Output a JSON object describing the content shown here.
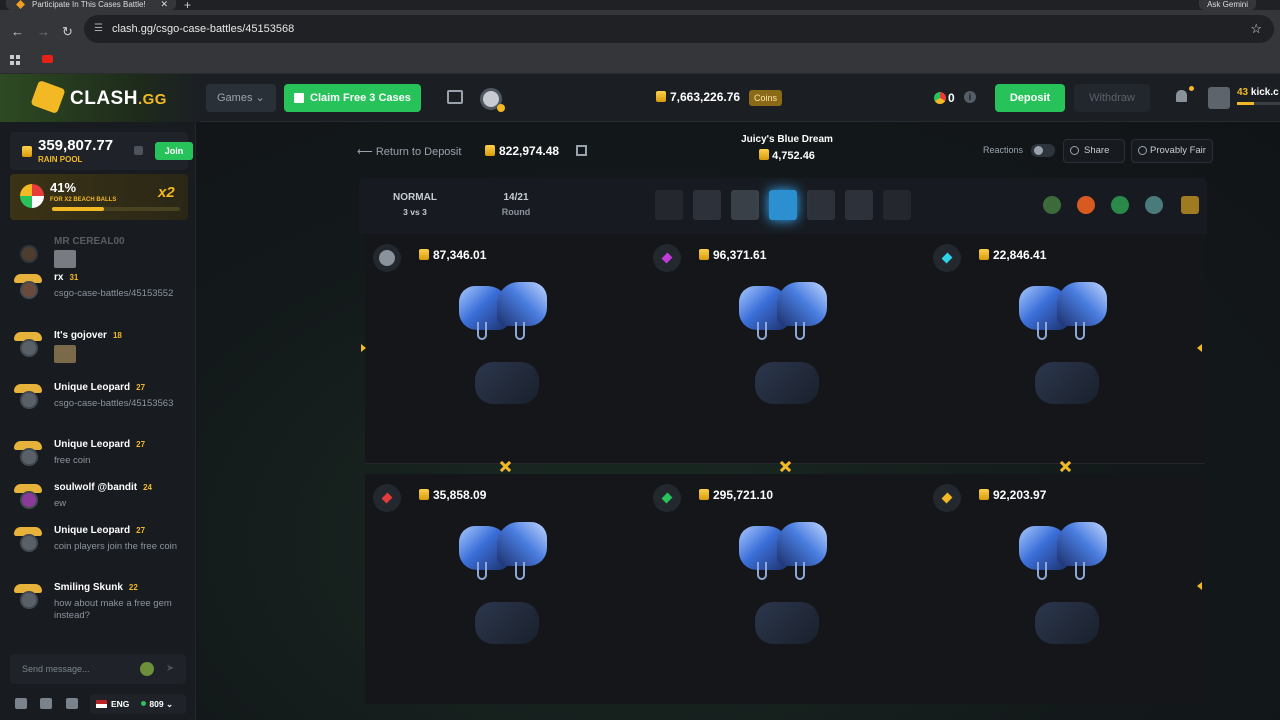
{
  "browser": {
    "tab_title": "Participate In This Cases Battle!",
    "new_tab": "+",
    "gemini": "Ask Gemini",
    "url": "clash.gg/csgo-case-battles/45153568"
  },
  "header": {
    "logo": "CLASH",
    "logo_suffix": ".GG",
    "games_label": "Games",
    "claim_label": "Claim Free 3 Cases",
    "balance": "7,663,226.76",
    "balance_badge": "Coins",
    "gems": "0",
    "info": "i",
    "deposit_label": "Deposit",
    "withdraw_label": "Withdraw",
    "user_level": "43",
    "user_name": "kick.c"
  },
  "sidebar": {
    "rain_amount": "359,807.77",
    "rain_label": "RAIN POOL",
    "join_label": "Join",
    "promo_pct": "41%",
    "promo_label": "FOR X2 BEACH BALLS",
    "promo_progress": 0.41,
    "promo_mult": "x2",
    "messages": [
      {
        "name": "MR CEREAL00",
        "level": "",
        "text": ""
      },
      {
        "name": "rx",
        "level": "31",
        "text": "csgo-case-battles/45153552"
      },
      {
        "name": "It's gojover",
        "level": "18",
        "text": ""
      },
      {
        "name": "Unique Leopard",
        "level": "27",
        "text": "csgo-case-battles/45153563"
      },
      {
        "name": "Unique Leopard",
        "level": "27",
        "text": "free coin"
      },
      {
        "name": "soulwolf @bandit",
        "level": "24",
        "text": "ew"
      },
      {
        "name": "Unique Leopard",
        "level": "27",
        "text": "coin players join the free coin"
      },
      {
        "name": "Smiling Skunk",
        "level": "22",
        "text": "how about make a free gem instead?"
      }
    ],
    "chat_placeholder": "Send message...",
    "lang": "ENG",
    "online": "809"
  },
  "battle": {
    "return_label": "Return to Deposit",
    "total_value": "822,974.48",
    "case_name": "Juicy's Blue Dream",
    "case_price": "4,752.46",
    "reactions_label": "Reactions",
    "share_label": "Share",
    "fair_label": "Provably Fair",
    "mode": "NORMAL",
    "mode_sub": "3 vs 3",
    "round": "14/21",
    "round_label": "Round",
    "players": [
      {
        "value": "87,346.01",
        "color": "#8a929c"
      },
      {
        "value": "96,371.61",
        "color": "#c23bd8"
      },
      {
        "value": "22,846.41",
        "color": "#2fd3e6"
      },
      {
        "value": "35,858.09",
        "color": "#e23b3b"
      },
      {
        "value": "295,721.10",
        "color": "#27c25a"
      },
      {
        "value": "92,203.97",
        "color": "#f3b924"
      }
    ]
  }
}
